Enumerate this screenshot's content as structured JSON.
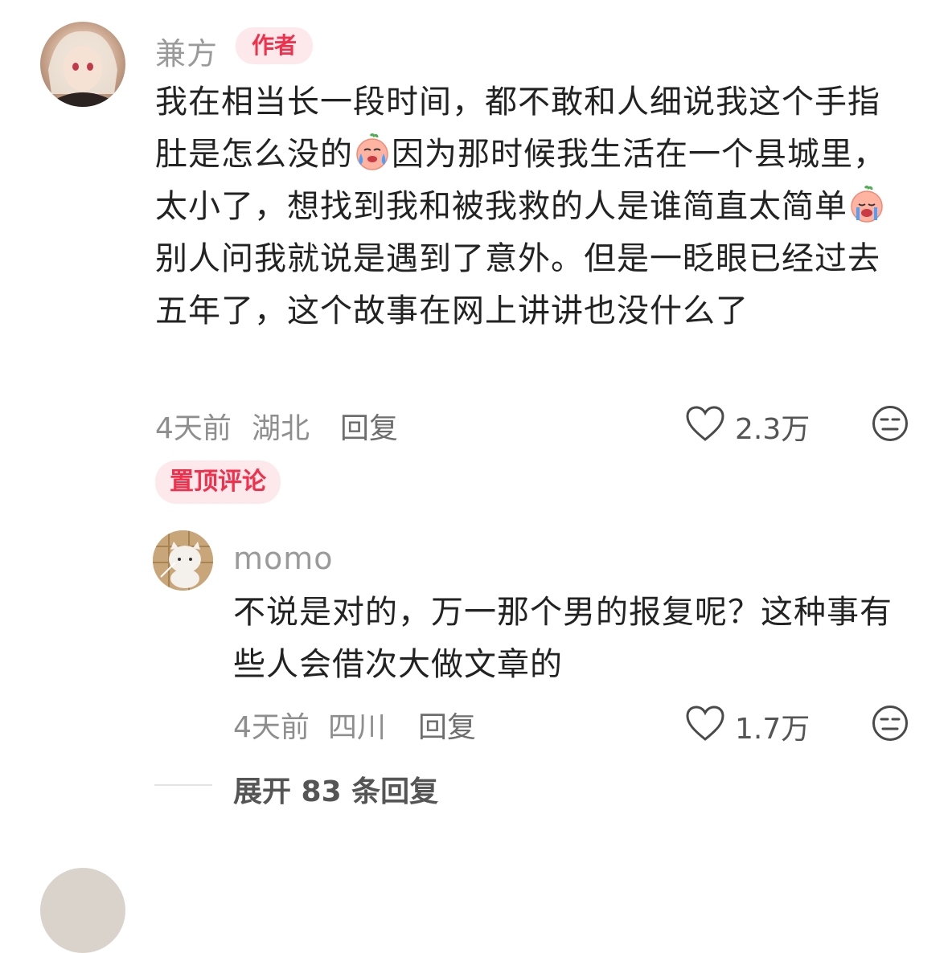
{
  "comment": {
    "author": "兼方",
    "author_tag": "作者",
    "text_part1": "我在相当长一段时间，都不敢和人细说我这个手指肚是怎么没的",
    "text_part2": "因为那时候我生活在一个县城里，太小了，想找到我和被我救的人是谁简直太简单",
    "text_part3": "别人问我就说是遇到了意外。但是一眨眼已经过去五年了，这个故事在网上讲讲也没什么了",
    "time": "4天前",
    "location": "湖北",
    "reply_label": "回复",
    "likes": "2.3万"
  },
  "pinned_label": "置顶评论",
  "reply": {
    "author": "momo",
    "text": "不说是对的，万一那个男的报复呢？这种事有些人会借次大做文章的",
    "time": "4天前",
    "location": "四川",
    "reply_label": "回复",
    "likes": "1.7万"
  },
  "expand_label": "展开 83 条回复",
  "icons": {
    "emoji1": "crying-face-emoji",
    "emoji2": "crying-face-emoji",
    "like": "heart-outline-icon",
    "dislike": "meh-face-icon"
  },
  "colors": {
    "accent": "#f2304b",
    "tag_bg": "#fde9ec"
  }
}
